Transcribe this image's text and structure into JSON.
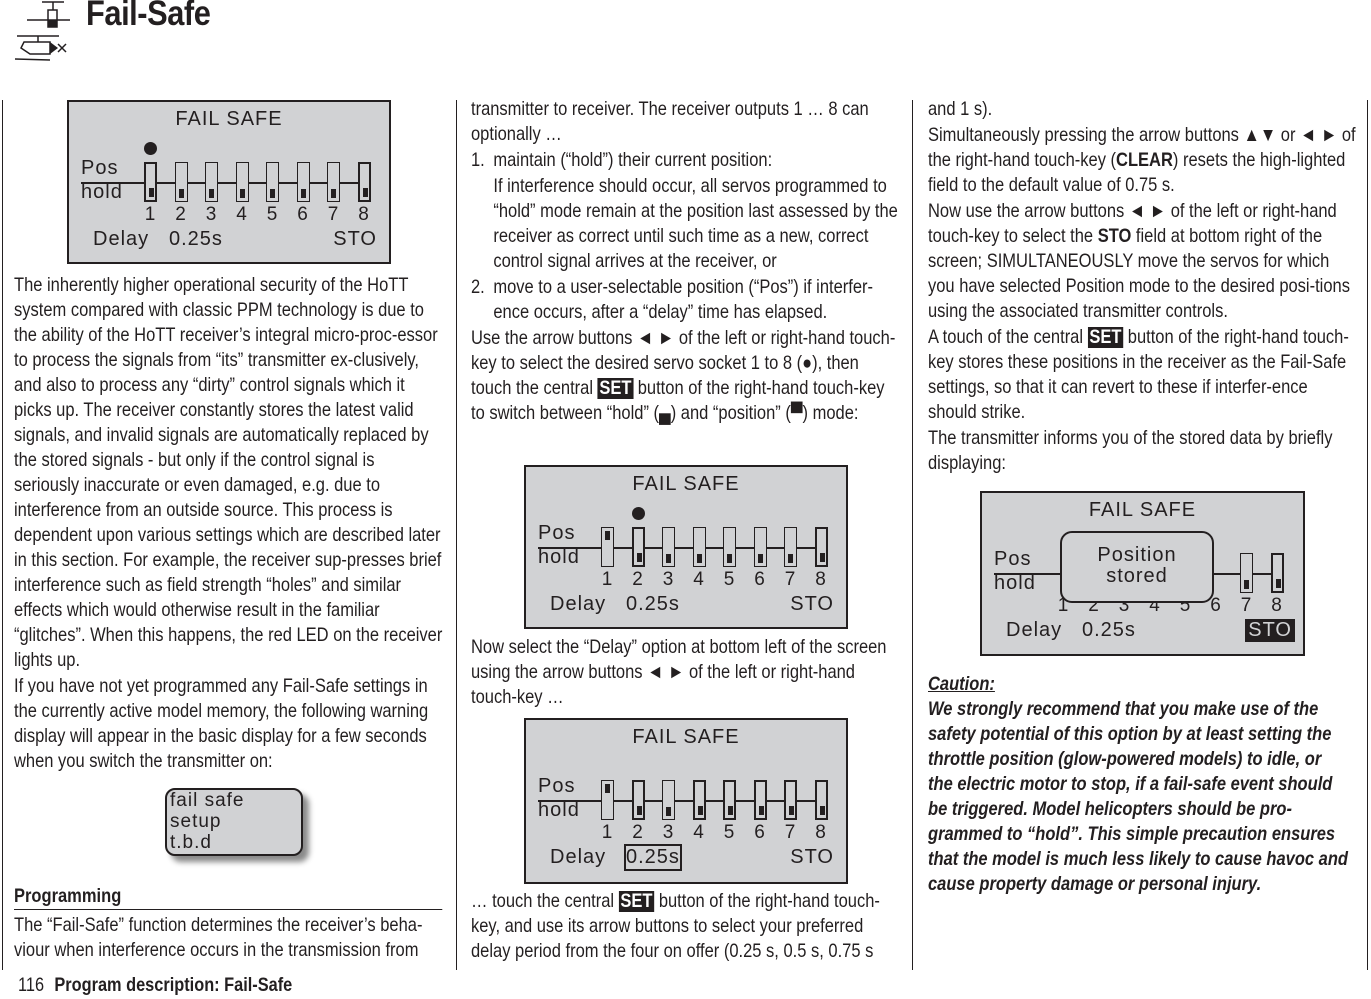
{
  "header": {
    "title": "Fail-Safe",
    "icons": [
      "airplane-model-icon",
      "helicopter-model-icon"
    ]
  },
  "footer": {
    "page_number": "116",
    "section": "Program description: Fail-Safe"
  },
  "screens": {
    "screen1": {
      "title": "FAIL SAFE",
      "pos_label": "Pos",
      "hold_label": "hold",
      "channels": [
        "1",
        "2",
        "3",
        "4",
        "5",
        "6",
        "7",
        "8"
      ],
      "modes": [
        "hold",
        "hold",
        "hold",
        "hold",
        "hold",
        "hold",
        "hold",
        "hold"
      ],
      "selected_channel": 1,
      "delay_label": "Delay",
      "delay_value": "0.25s",
      "store_label": "STO"
    },
    "screen2": {
      "title": "FAIL SAFE",
      "pos_label": "Pos",
      "hold_label": "hold",
      "channels": [
        "1",
        "2",
        "3",
        "4",
        "5",
        "6",
        "7",
        "8"
      ],
      "modes": [
        "pos",
        "hold",
        "hold",
        "hold",
        "hold",
        "hold",
        "hold",
        "hold"
      ],
      "selected_channel": 2,
      "delay_label": "Delay",
      "delay_value": "0.25s",
      "store_label": "STO"
    },
    "screen3": {
      "title": "FAIL SAFE",
      "pos_label": "Pos",
      "hold_label": "hold",
      "channels": [
        "1",
        "2",
        "3",
        "4",
        "5",
        "6",
        "7",
        "8"
      ],
      "modes": [
        "pos",
        "hold",
        "hold",
        "hold",
        "hold",
        "hold",
        "hold",
        "hold"
      ],
      "selected_field": "delay",
      "delay_label": "Delay",
      "delay_value": "0.25s",
      "store_label": "STO"
    },
    "screen4": {
      "title": "FAIL SAFE",
      "pos_label": "Pos",
      "hold_label": "hold",
      "channels": [
        "1",
        "2",
        "3",
        "4",
        "5",
        "6",
        "7",
        "8"
      ],
      "popup_line1": "Position",
      "popup_line2": "stored",
      "selected_field": "store",
      "delay_label": "Delay",
      "delay_value": "0.25s",
      "store_label": "STO"
    },
    "warning": {
      "line1": "fail safe",
      "line2": "setup",
      "line3": "t.b.d"
    }
  },
  "col1": {
    "p1": "The inherently higher operational security of the HoTT system compared with classic PPM technology is due to the ability of the HoTT receiver’s integral micro-proc-essor to process the signals from “its” transmitter ex-clusively, and also to process any “dirty” control signals which it picks up. The receiver constantly stores the latest valid signals, and invalid signals are automatically replaced by the stored signals - but only if the control signal is seriously inaccurate or even damaged, e.g. due to interference from an outside source. This process is dependent upon various settings which are described later in this section. For example, the receiver sup-presses brief interference such as field strength “holes” and similar effects which would otherwise result in the familiar “glitches”. When this happens, the red LED on the receiver lights up.",
    "p2": "If you have not yet programmed any Fail-Safe settings in the currently active model memory, the following warning display will appear in the basic display for a few seconds when you switch the transmitter on:",
    "heading": "Programming",
    "p3": "The “Fail-Safe” function determines the receiver’s beha-viour when interference occurs in the transmission from"
  },
  "col2": {
    "p1": "transmitter to receiver. The receiver outputs 1 … 8 can optionally …",
    "item1_num": "1.",
    "item1": "maintain (“hold”) their current position:",
    "item1_sub": "If interference should occur, all servos programmed to “hold” mode remain at the position last assessed by the receiver as correct until such time as a new, correct control signal arrives at the receiver, or",
    "item2_num": "2.",
    "item2": "move to a user-selectable position (“Pos”) if interfer-ence occurs, after a “delay” time has elapsed.",
    "p2a": "Use the arrow buttons ◄ ► of the left or right-hand touch-key to select the desired servo socket 1 to 8 (●), then touch the central",
    "set": "SET",
    "p2b": "button of the right-hand touch-key to switch between “hold” (▄) and “position” (▀) mode:",
    "p3": "Now select the “Delay” option at bottom left of the screen using the arrow buttons ◄ ► of the left or right-hand touch-key …",
    "p4a": "… touch the central",
    "p4b": "button of the right-hand touch-key, and use its arrow buttons to select your preferred delay period from the four on offer (0.25 s, 0.5 s, 0.75 s"
  },
  "col3": {
    "p1": "and 1 s).",
    "p2a": "Simultaneously pressing the arrow buttons ▲▼ or ◄ ► of the right-hand touch-key (",
    "clear": "CLEAR",
    "p2b": ") resets the high-lighted field to the default value of 0.75 s.",
    "p3a": "Now use the arrow buttons ◄ ► of the left or right-hand touch-key to select the",
    "sto": "STO",
    "p3b": "field at bottom right of the screen; SIMULTANEOUSLY move the servos for which you have selected Position mode to the desired posi-tions using the associated transmitter controls.",
    "p4a": "A touch of the central",
    "set": "SET",
    "p4b": "button of the right-hand touch-key stores these positions in the receiver as the Fail-Safe settings, so that it can revert to these if interfer-ence should strike.",
    "p5": "The transmitter informs you of the stored data by briefly displaying:",
    "caution_heading": "Caution:",
    "caution_text": "We strongly recommend that you make use of the safety potential of this option by at least setting the throttle position (glow-powered models) to idle, or the electric motor to stop, if a fail-safe event should be triggered. Model helicopters should be pro-grammed to “hold”. This simple precaution ensures that the model is much less likely to cause havoc and cause property damage or personal injury."
  }
}
